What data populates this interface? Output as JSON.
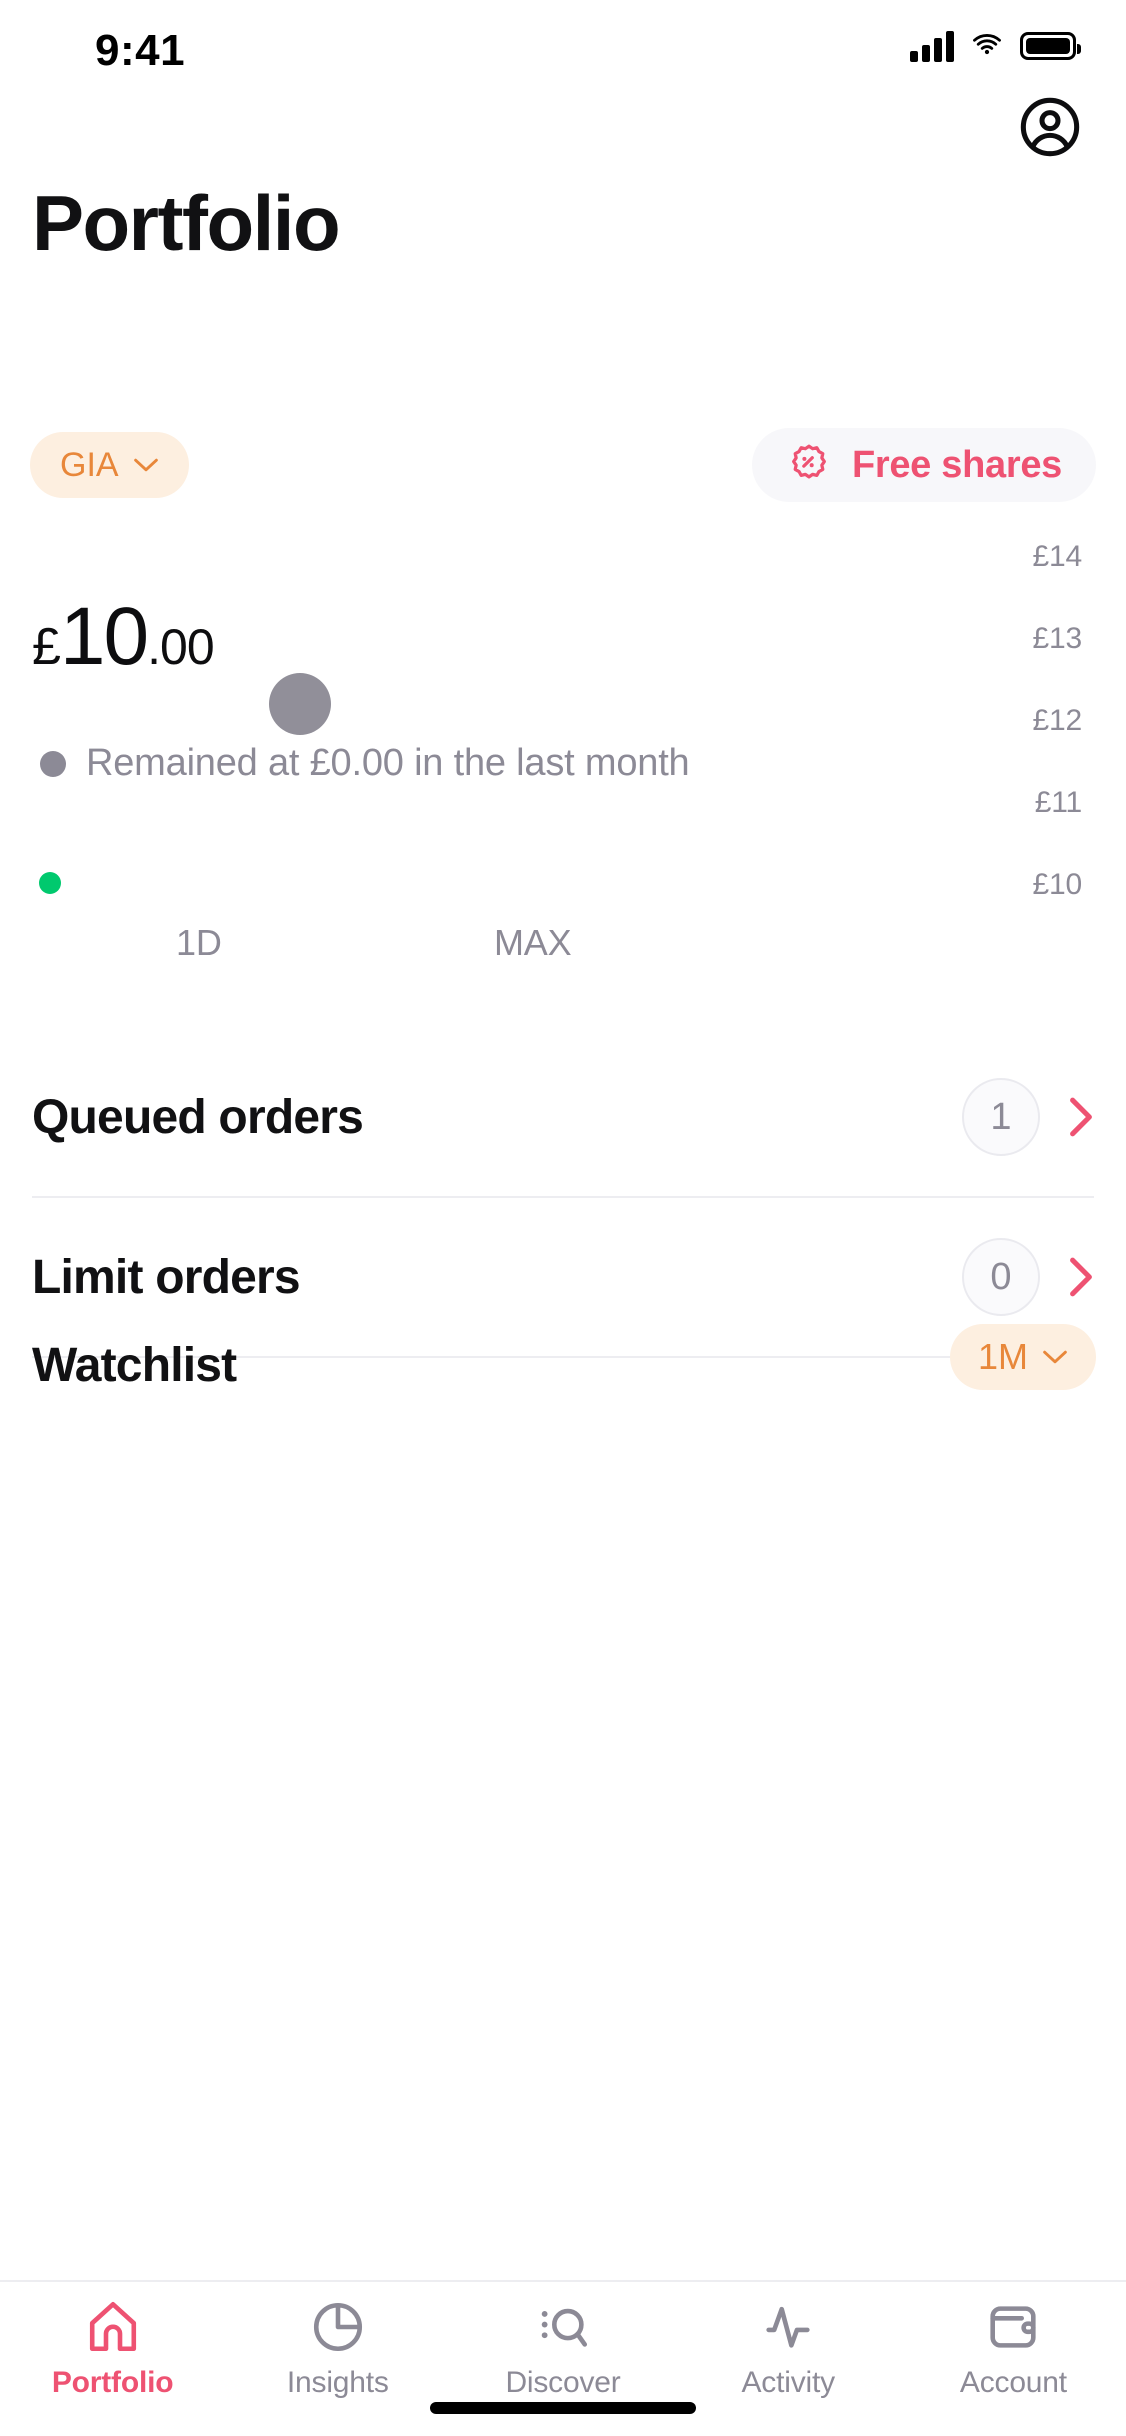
{
  "status_bar": {
    "time": "9:41",
    "cellular_icon": "cellular-signal-icon",
    "wifi_icon": "wifi-icon",
    "battery_icon": "battery-full-icon"
  },
  "header": {
    "title": "Portfolio",
    "account_icon": "account-circle-icon"
  },
  "account_selector": {
    "label": "GIA",
    "chevron_icon": "chevron-down-icon",
    "bg_color": "#FDEFE0",
    "text_color": "#E8873A"
  },
  "free_shares": {
    "label": "Free shares",
    "icon": "ticket-percent-icon",
    "bg_color": "#F7F7FA",
    "text_color": "#EE5272"
  },
  "balance": {
    "currency": "£",
    "integer": "10",
    "decimal": ".00",
    "change_text": "Remained at £0.00 in the last month",
    "change_dot_color": "#8C8A96"
  },
  "chart_data": {
    "type": "line",
    "title": "",
    "xlabel": "",
    "ylabel": "",
    "ylim": [
      10,
      14
    ],
    "y_ticks": [
      "£10",
      "£11",
      "£12",
      "£13",
      "£14"
    ],
    "y_tick_values": [
      10,
      11,
      12,
      13,
      14
    ],
    "grid": false,
    "legend": "none",
    "series": [
      {
        "name": "Portfolio value",
        "color": "#00C96E",
        "x": [
          0
        ],
        "values": [
          10
        ]
      }
    ],
    "markers": [
      {
        "name": "current-value-marker",
        "x": 0,
        "y": 10,
        "color": "#00C96E",
        "size": "small"
      },
      {
        "name": "hover-marker",
        "x": 0.35,
        "y": 12.2,
        "color": "#918F99",
        "size": "large"
      }
    ],
    "range_labels": [
      "1D",
      "MAX"
    ]
  },
  "orders": [
    {
      "name": "Queued orders",
      "count": "1",
      "chevron_icon": "chevron-right-icon"
    },
    {
      "name": "Limit orders",
      "count": "0",
      "chevron_icon": "chevron-right-icon"
    }
  ],
  "watchlist": {
    "title": "Watchlist",
    "period": "1M",
    "chevron_icon": "chevron-down-icon"
  },
  "tabs": [
    {
      "label": "Portfolio",
      "icon": "home-icon",
      "active": true
    },
    {
      "label": "Insights",
      "icon": "pie-chart-icon",
      "active": false
    },
    {
      "label": "Discover",
      "icon": "search-list-icon",
      "active": false
    },
    {
      "label": "Activity",
      "icon": "activity-pulse-icon",
      "active": false
    },
    {
      "label": "Account",
      "icon": "wallet-icon",
      "active": false
    }
  ],
  "colors": {
    "accent_pink": "#EE5272",
    "accent_orange": "#E8873A",
    "positive_green": "#00C96E",
    "muted_gray": "#8C8A96"
  }
}
